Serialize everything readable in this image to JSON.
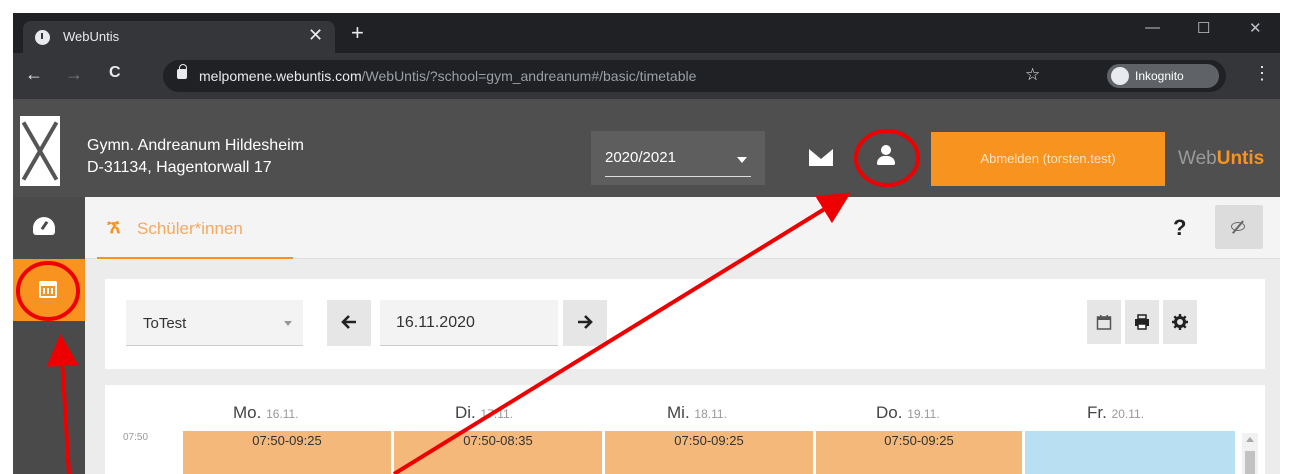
{
  "browser": {
    "tab_title": "WebUntis",
    "tab_close": "✕",
    "new_tab": "+",
    "url_host": "melpomene.webuntis.com",
    "url_path": "/WebUntis/?school=gym_andreanum#/basic/timetable",
    "incognito_label": "Inkognito",
    "back": "←",
    "forward": "→",
    "reload": "C",
    "star": "☆",
    "menu": "⋮",
    "minimize": "—",
    "maximize": "☐",
    "close": "✕"
  },
  "header": {
    "school_name": "Gymn. Andreanum Hildesheim",
    "school_address": "D-31134, Hagentorwall 17",
    "school_year": "2020/2021",
    "logout_label": "Abmelden (torsten.test)",
    "brand_web": "Web",
    "brand_untis": "Untis"
  },
  "subheader": {
    "tab_label": "Schüler*innen",
    "help": "?"
  },
  "toolbar": {
    "class_value": "ToTest",
    "prev": "🡐",
    "date_value": "16.11.2020",
    "next": "🡒"
  },
  "timetable": {
    "days": [
      {
        "name": "Mo.",
        "date": "16.11."
      },
      {
        "name": "Di.",
        "date": "17.11."
      },
      {
        "name": "Mi.",
        "date": "18.11."
      },
      {
        "name": "Do.",
        "date": "19.11."
      },
      {
        "name": "Fr.",
        "date": "20.11."
      }
    ],
    "start_time": "07:50",
    "lessons": [
      "07:50-09:25",
      "07:50-08:35",
      "07:50-09:25",
      "07:50-09:25"
    ]
  },
  "colors": {
    "accent": "#f7931e",
    "header_bg": "#4f4f4f",
    "annotation": "#ee0000"
  }
}
